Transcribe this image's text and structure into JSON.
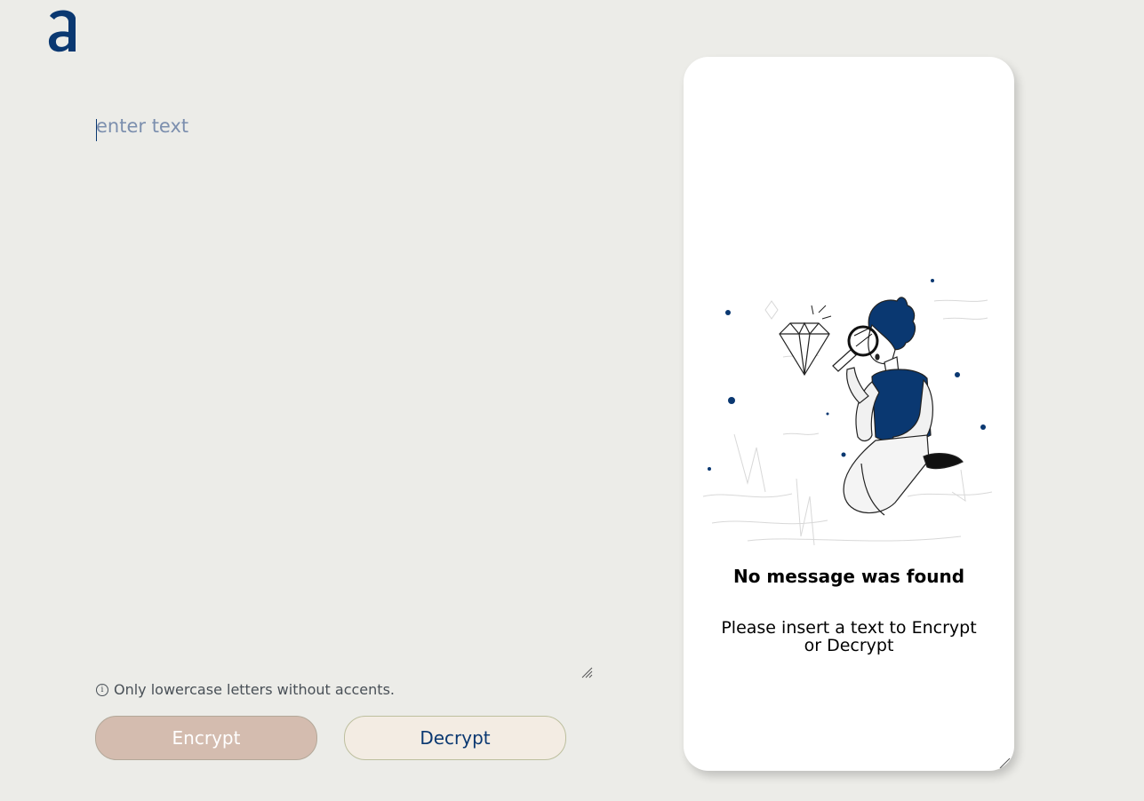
{
  "brand": {
    "logo_icon": "alura-a-logo-icon",
    "accent_color": "#0A3871"
  },
  "input": {
    "placeholder": "enter text",
    "value": ""
  },
  "hint": {
    "icon": "info-icon",
    "icon_glyph": "i",
    "text": "Only lowercase letters without accents."
  },
  "buttons": {
    "encrypt_label": "Encrypt",
    "decrypt_label": "Decrypt",
    "encrypt_color": "#D4BCAF",
    "decrypt_color": "#F3ECE3"
  },
  "output": {
    "illustration": "person-with-magnifying-glass-looking-at-diamond",
    "title": "No message was found",
    "message": "Please insert a text to Encrypt or Decrypt"
  }
}
